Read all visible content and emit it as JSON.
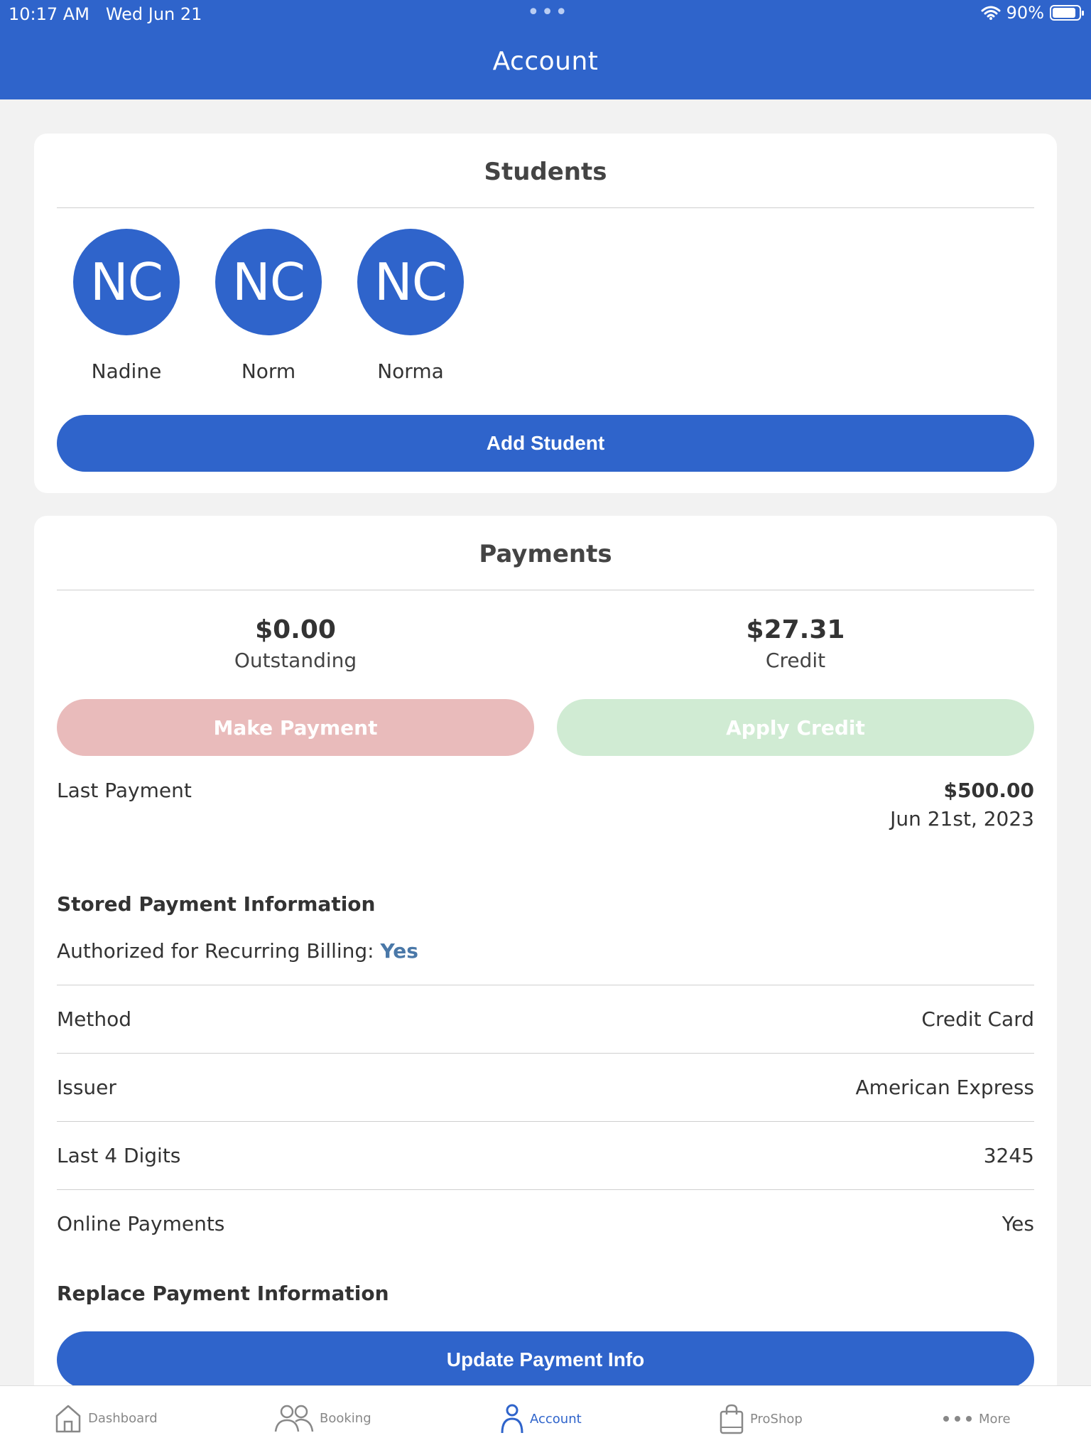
{
  "status_bar": {
    "time": "10:17 AM",
    "date": "Wed Jun 21",
    "battery": "90%",
    "battery_level": 0.9
  },
  "header": {
    "title": "Account"
  },
  "students": {
    "title": "Students",
    "items": [
      {
        "initials": "NC",
        "name": "Nadine"
      },
      {
        "initials": "NC",
        "name": "Norm"
      },
      {
        "initials": "NC",
        "name": "Norma"
      }
    ],
    "add_button": "Add Student"
  },
  "payments": {
    "title": "Payments",
    "outstanding_value": "$0.00",
    "outstanding_label": "Outstanding",
    "credit_value": "$27.31",
    "credit_label": "Credit",
    "make_payment_button": "Make Payment",
    "apply_credit_button": "Apply Credit",
    "last_payment_label": "Last Payment",
    "last_payment_amount": "$500.00",
    "last_payment_date": "Jun 21st, 2023",
    "stored_heading": "Stored Payment Information",
    "recurring_label": "Authorized for Recurring Billing:",
    "recurring_value": "Yes",
    "rows": [
      {
        "label": "Method",
        "value": "Credit Card"
      },
      {
        "label": "Issuer",
        "value": "American Express"
      },
      {
        "label": "Last 4 Digits",
        "value": "3245"
      },
      {
        "label": "Online Payments",
        "value": "Yes"
      }
    ],
    "replace_heading": "Replace Payment Information",
    "update_button": "Update Payment Info"
  },
  "tabs": [
    {
      "label": "Dashboard",
      "icon": "home-icon"
    },
    {
      "label": "Booking",
      "icon": "people-icon"
    },
    {
      "label": "Account",
      "icon": "person-icon",
      "active": true
    },
    {
      "label": "ProShop",
      "icon": "shopping-bag-icon"
    },
    {
      "label": "More",
      "icon": "more-dots-icon"
    }
  ],
  "colors": {
    "primary": "#2f64cb",
    "make_payment": "#e9bbbb",
    "apply_credit": "#d0ebd3",
    "recurring_yes": "#4a78a8"
  }
}
